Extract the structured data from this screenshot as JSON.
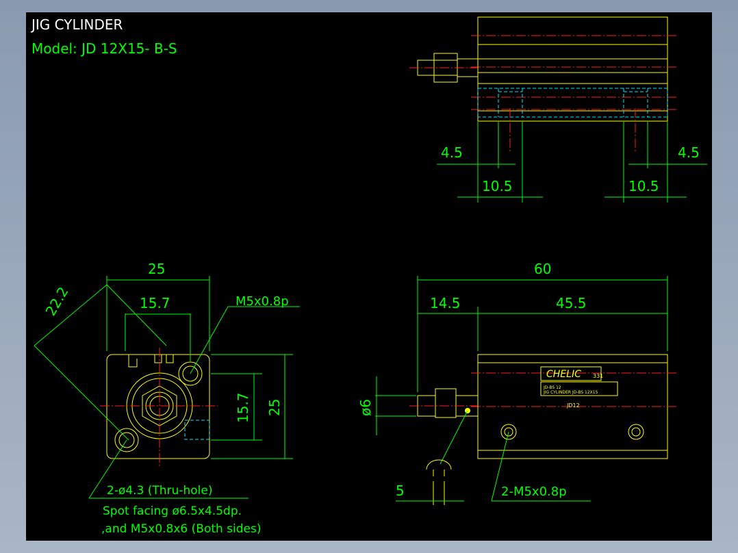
{
  "title": "JIG CYLINDER",
  "model": "Model:  JD 12X15- B-S",
  "top_view": {
    "dim_left_small": "4.5",
    "dim_right_small": "4.5",
    "dim_left_wide": "10.5",
    "dim_right_wide": "10.5"
  },
  "end_view": {
    "dim_width": "25",
    "dim_inner": "15.7",
    "dim_diag": "22.2",
    "dim_height": "25",
    "dim_height_inner": "15.7",
    "thread_label": "M5x0.8p",
    "hole_note": "2-ø4.3 (Thru-hole)",
    "spot_note": "Spot facing ø6.5x4.5dp.",
    "spot_note2": ",and M5x0.8x6 (Both sides)"
  },
  "side_view": {
    "dim_total": "60",
    "dim_rod": "14.5",
    "dim_body": "45.5",
    "dim_dia": "ø6",
    "dim_small": "5",
    "port_note": "2-M5x0.8p",
    "brand": "CHELIC",
    "brand_code": "331",
    "plate_line1": "JD-BS 12",
    "plate_line2": "JIG CYLINDER  JD-BS 12X15",
    "body_mark": "JD12"
  }
}
